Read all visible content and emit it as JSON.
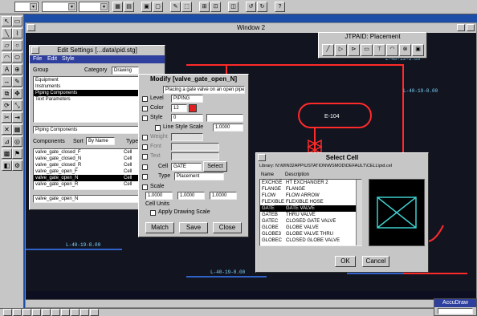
{
  "window2": {
    "title": "Window 2"
  },
  "placement_toolbox": {
    "title": "JTPAID: Placement"
  },
  "edit_settings": {
    "title": "Edit Settings [...data\\pid.stg]",
    "menu": [
      "File",
      "Edit",
      "Style"
    ],
    "group_label": "Group",
    "category_label": "Category",
    "category_value": "Drawing",
    "groups": [
      "Equipment",
      "Instruments",
      "Piping Components",
      "Text Parameters"
    ],
    "selected_group": "Piping Components",
    "components_label": "Components",
    "sort_label": "Sort",
    "sort_value": "By Name",
    "type_label": "Type",
    "components": [
      {
        "name": "valve_gate_closed_F",
        "type": "Cell"
      },
      {
        "name": "valve_gate_closed_N",
        "type": "Cell"
      },
      {
        "name": "valve_gate_closed_R",
        "type": "Cell"
      },
      {
        "name": "valve_gate_open_F",
        "type": "Cell"
      },
      {
        "name": "valve_gate_open_N",
        "type": "Cell"
      },
      {
        "name": "valve_gate_open_R",
        "type": "Cell"
      }
    ],
    "selected_component": "valve_gate_open_N"
  },
  "modify_dialog": {
    "title": "Modify [valve_gate_open_N]",
    "rows": [
      {
        "label": "Level",
        "value": "PIPING"
      },
      {
        "label": "Color",
        "value": "12"
      },
      {
        "label": "Style",
        "value": "0"
      },
      {
        "label": "Weight",
        "value": ""
      },
      {
        "label": "Line Style Scale",
        "value": "1.0000"
      },
      {
        "label": "Font",
        "value": ""
      },
      {
        "label": "Text",
        "value": ""
      },
      {
        "label": "Cell",
        "value": "GATE"
      },
      {
        "label": "Type",
        "value": "Placement"
      },
      {
        "label": "Scale",
        "value": "1.0000"
      }
    ],
    "description": "Placing a gate valve on an open pipe",
    "select_label": "Select",
    "scale_values": [
      "1.0000",
      "1.0000",
      "1.0000"
    ],
    "cell_units_label": "Cell Units",
    "apply_drawing_scale_label": "Apply Drawing Scale",
    "buttons": [
      "Match",
      "Save",
      "Close"
    ]
  },
  "select_cell": {
    "title": "Select Cell",
    "library": "Library: N:\\WIN32APP\\USTATION\\WSMOD\\DEFAULT\\CELL\\pid.cel",
    "columns": [
      "Name",
      "Description"
    ],
    "cells": [
      {
        "name": "EXCHGE",
        "desc": "HT EXCHANGER 2"
      },
      {
        "name": "FLANGE",
        "desc": "FLANGE"
      },
      {
        "name": "FLOW",
        "desc": "FLOW ARROW"
      },
      {
        "name": "FLEXIBLE",
        "desc": "FLEXIBLE HOSE"
      },
      {
        "name": "GATE",
        "desc": "GATE VALVE"
      },
      {
        "name": "GATEB",
        "desc": "THRU VALVE"
      },
      {
        "name": "GATEC",
        "desc": "CLOSED GATE VALVE"
      },
      {
        "name": "GLOBE",
        "desc": "GLOBE VALVE"
      },
      {
        "name": "GLOBE3",
        "desc": "GLOBE VALVE THRU"
      },
      {
        "name": "GLOBEC",
        "desc": "CLOSED GLOBE VALVE"
      }
    ],
    "selected_cell": "GATE",
    "buttons": [
      "OK",
      "Cancel"
    ]
  },
  "drawing": {
    "equipment_tag": "E-104",
    "line_tags": [
      "L-40-19-8.00",
      "L-40-19-8.00",
      "L-40-19-8.00",
      "L-40-19-8.00"
    ]
  },
  "accudraw": {
    "title": "AccuDraw"
  },
  "colors": {
    "pipe_red": "#ff2a2a",
    "pipe_blue": "#3b7dff",
    "tag_cyan": "#7fd8ff",
    "canvas_bg": "#121420"
  }
}
